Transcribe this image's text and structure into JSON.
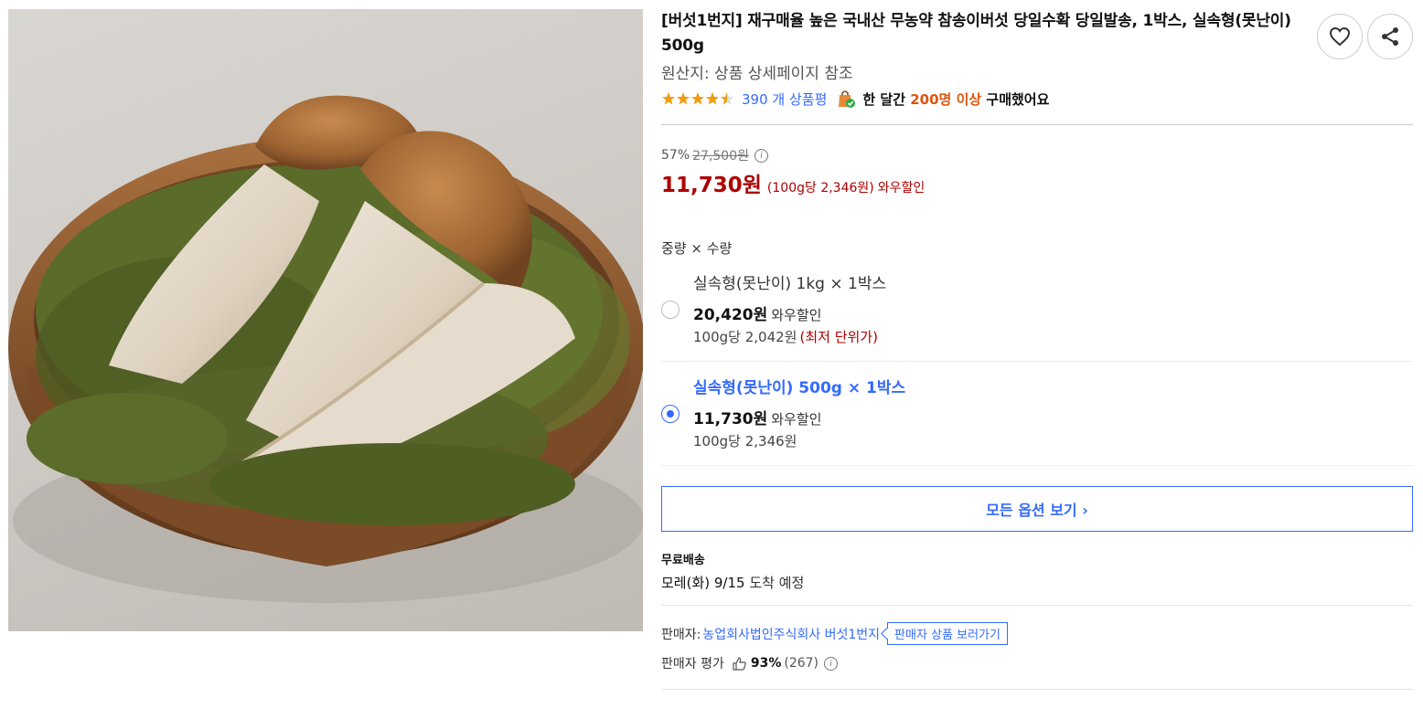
{
  "product": {
    "image_alt": "송이버섯",
    "title": "[버섯1번지] 재구매율 높은 국내산 무농약 참송이버섯 당일수확 당일발송, 1박스, 실속형(못난이) 500g",
    "origin": "원산지: 상품 상세페이지 참조",
    "rating": 4.5,
    "review_count": "390 개 상품평",
    "buyers_prefix": "한 달간 ",
    "buyers_highlight": "200명 이상",
    "buyers_suffix": " 구매했어요"
  },
  "actions": {
    "heart_icon": "heart-icon",
    "share_icon": "share-icon"
  },
  "price": {
    "discount_rate": "57%",
    "original_price": "27,500원",
    "sale_price": "11,730원",
    "unit_price": "(100g당 2,346원)",
    "wow_label": "와우할인"
  },
  "options": {
    "header": "중량 × 수량",
    "items": [
      {
        "name": "실속형(못난이) 1kg × 1박스",
        "price": "20,420원",
        "wow": "와우할인",
        "unit": "100g당 2,042원",
        "best": "(최저 단위가)",
        "selected": false
      },
      {
        "name": "실속형(못난이) 500g × 1박스",
        "price": "11,730원",
        "wow": "와우할인",
        "unit": "100g당 2,346원",
        "best": "",
        "selected": true
      }
    ],
    "all_button": "모든 옵션 보기 ›"
  },
  "shipping": {
    "title": "무료배송",
    "date": "모레(화) 9/15",
    "date_suffix": " 도착 예정"
  },
  "seller": {
    "label": "판매자:",
    "name": "농업회사법인주식회사 버섯1번지",
    "go_button": "판매자 상품 보러가기",
    "rating_label": "판매자 평가",
    "rating_pct": "93%",
    "rating_count": "(267)"
  },
  "colors": {
    "accent": "#346aff",
    "price": "#ae0000",
    "highlight": "#e0540b"
  }
}
